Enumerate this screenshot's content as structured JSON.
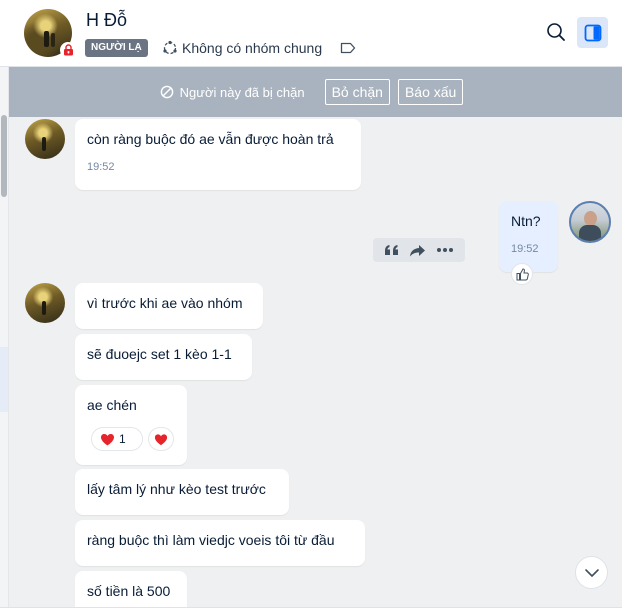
{
  "header": {
    "contact_name": "H Đỗ",
    "stranger_badge": "NGƯỜI LẠ",
    "mutual_groups": "Không có nhóm chung"
  },
  "blocked_bar": {
    "message": "Người này đã bị chặn",
    "unblock_label": "Bỏ chặn",
    "report_label": "Báo xấu"
  },
  "messages": [
    {
      "text": "còn ràng buộc đó ae vẫn được hoàn trả",
      "time": "19:52"
    },
    {
      "text": "Ntn?",
      "time": "19:52"
    },
    {
      "text": "vì trước khi ae vào nhóm"
    },
    {
      "text": "sẽ đuoejc set 1 kèo 1-1"
    },
    {
      "text": "ae chén"
    },
    {
      "text": "lấy tâm lý như kèo test trước"
    },
    {
      "text": "ràng buộc thì làm viedjc voeis tôi từ đầu"
    },
    {
      "text": "số tiền là 500"
    }
  ],
  "reactions": {
    "heart_count": "1"
  },
  "colors": {
    "accent": "#0068ff",
    "reaction": "#e5242b",
    "blocked_bar": "#a9b3bf"
  },
  "icons": [
    "lock-icon",
    "group-icon",
    "tag-icon",
    "search-icon",
    "sidebar-panel-icon",
    "blocked-icon",
    "quote-icon",
    "share-icon",
    "more-icon",
    "thumbs-up-icon",
    "heart-icon",
    "chevron-down-icon"
  ]
}
